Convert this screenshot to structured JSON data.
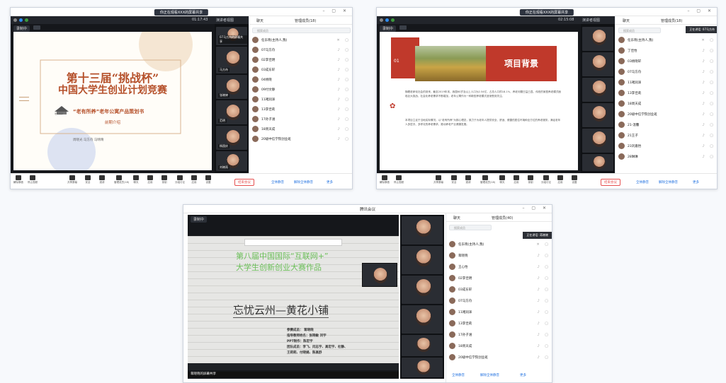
{
  "windows": {
    "w1": {
      "title_pill": "你正在观看XXX的屏幕共享",
      "clock": "01:17:43",
      "view_label": "演讲者视图",
      "rec_label": "录制中",
      "slide": {
        "title1": "第十三届“挑战杯”",
        "title2": "中国大学生创业计划竞赛",
        "subtitle": "“老有所养”老年公寓产品策划书",
        "sub2": "前期介绍",
        "authors": "周晓光  马方舟  马晴晴",
        "logo_text": "老有所养"
      },
      "thumb_names": [
        "07马方舟的屏幕共享",
        "马方舟",
        "张晓婷",
        "范明",
        "杨国庆",
        "刘晓雨"
      ],
      "panel": {
        "tab_chat": "聊天",
        "tab_members": "管理成员(18)",
        "search": "搜索成员",
        "members": [
          "任东晓(主持人,我)",
          "07马方舟",
          "02李佳明",
          "03成东轩",
          "04杨晓",
          "09付文静",
          "11褚润泽",
          "13李佳莉",
          "17孙子涵",
          "18周天成",
          "20级中信学院创业班"
        ]
      },
      "toolbar": [
        "解除静音",
        "停止视频",
        "共享屏幕",
        "安全",
        "邀请",
        "管理成员(18)",
        "聊天",
        "应用",
        "录制",
        "分组讨论",
        "应用",
        "设置"
      ],
      "end_btn": "结束会议",
      "bottom_links": [
        "全体静音",
        "解除全体静音",
        "更多"
      ]
    },
    "w2": {
      "title_pill": "你正在观看XXX的屏幕共享",
      "clock": "02:15:08",
      "view_label": "演讲者视图",
      "rec_label": "录制中",
      "tooltip": "正在讲话: 07马方舟",
      "slide": {
        "heading": "项目背景",
        "badge": "01",
        "para1": "随着老龄化社会的到来，截至2019年末，我国60岁及以上人口为2.54亿，占总人口的18.1%，养老问题日益凸显。传统的家庭养老模式面临巨大挑战，社会化养老需求不断增加，老年公寓作为一种新型养老模式逐渐受到关注。",
        "para2": "本项目立足于当地实际情况，以“老有所养”为核心理念，致力于为老年人提供安全、舒适、便捷的居住环境和全方位的养老服务，满足老年人多层次、多样化的养老需求，推动养老产业健康发展。"
      },
      "panel": {
        "tab_chat": "聊天",
        "tab_members": "管理成员(18)",
        "search": "搜索成员",
        "members": [
          "任东晓(主持人,我)",
          "丁佳怡",
          "03杨晓轩",
          "07马方舟",
          "11褚润泽",
          "13李佳莉",
          "18周天成",
          "20级中信学院创业班",
          "21-温馨",
          "21王子",
          "23刘嘉怡",
          "28琳琳"
        ]
      },
      "toolbar": [
        "解除静音",
        "停止视频",
        "共享屏幕",
        "安全",
        "邀请",
        "管理成员(18)",
        "聊天",
        "应用",
        "录制",
        "分组讨论",
        "应用",
        "设置"
      ],
      "end_btn": "结束会议",
      "bottom_links": [
        "全体静音",
        "解除全体静音",
        "更多"
      ]
    },
    "w3": {
      "title": "腾讯会议",
      "rec_label": "录制中",
      "tooltip": "正在讲话: 蒋晓晓",
      "slide": {
        "title1": "第八届中国国际“互联网+”",
        "title2": "大学生创新创业大赛作品",
        "main": "忘忧云州—黄花小铺",
        "credits": [
          "参赛成员：    蒋晓晓",
          "指导教师姓名：张晓敏  刘宇",
          "PPT制作：陈宏宇",
          "团队成员：李飞、闫志宇、高宏宇、杜静、",
          "  王莉莉、付晓娟、陈高舒"
        ]
      },
      "share_label": "蒋晓晓的屏幕共享",
      "panel": {
        "tab_chat": "聊天",
        "tab_members": "管理成员(40)",
        "search": "搜索成员",
        "members": [
          "任东晓(主持人,我)",
          "蒋晓晓",
          "王心怡",
          "02李佳明",
          "03成东轩",
          "07马方舟",
          "11褚润泽",
          "13李佳莉",
          "17孙子涵",
          "18周天成",
          "20级中信学院创业班"
        ]
      },
      "bottom_links": [
        "全体静音",
        "解除全体静音",
        "更多"
      ]
    }
  },
  "colors": {
    "accent_red": "#c0392b",
    "brown": "#b5502a",
    "blue": "#1e6fe0",
    "green": "#3c9a3c"
  }
}
